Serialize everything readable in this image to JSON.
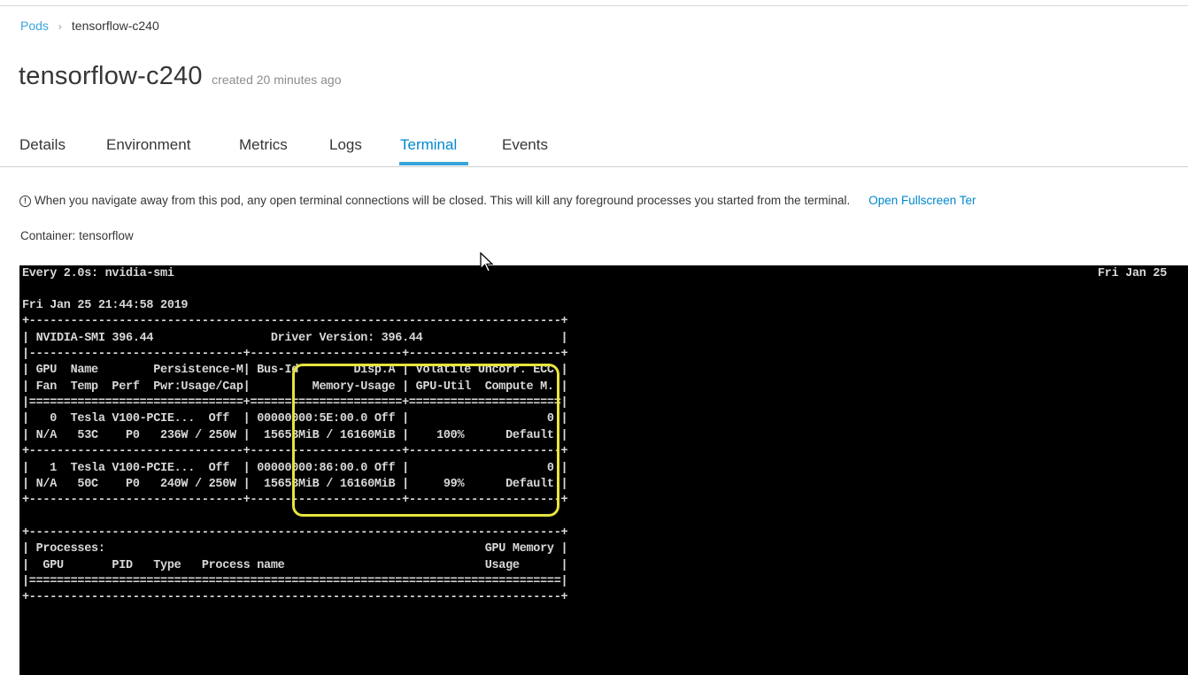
{
  "breadcrumb": {
    "root": "Pods",
    "separator": "›",
    "current": "tensorflow-c240"
  },
  "title": {
    "name": "tensorflow-c240",
    "meta": "created 20 minutes ago"
  },
  "tabs": [
    {
      "label": "Details"
    },
    {
      "label": "Environment"
    },
    {
      "label": "Metrics"
    },
    {
      "label": "Logs"
    },
    {
      "label": "Terminal",
      "active": true
    },
    {
      "label": "Events"
    }
  ],
  "notice": {
    "icon": "info-icon",
    "icon_glyph": "!",
    "text": "When you navigate away from this pod, any open terminal connections will be closed. This will kill any foreground processes you started from the terminal.",
    "link": "Open Fullscreen Ter"
  },
  "container": {
    "label": "Container:",
    "value": "tensorflow"
  },
  "terminal": {
    "header_left": "Every 2.0s: nvidia-smi",
    "header_right": "Fri Jan 25",
    "lines": [
      "Fri Jan 25 21:44:58 2019",
      "+-----------------------------------------------------------------------------+",
      "| NVIDIA-SMI 396.44                 Driver Version: 396.44                    |",
      "|-------------------------------+----------------------+----------------------+",
      "| GPU  Name        Persistence-M| Bus-Id        Disp.A | Volatile Uncorr. ECC |",
      "| Fan  Temp  Perf  Pwr:Usage/Cap|         Memory-Usage | GPU-Util  Compute M. |",
      "|===============================+======================+======================|",
      "|   0  Tesla V100-PCIE...  Off  | 00000000:5E:00.0 Off |                    0 |",
      "| N/A   53C    P0   236W / 250W |  15653MiB / 16160MiB |    100%      Default |",
      "+-------------------------------+----------------------+----------------------+",
      "|   1  Tesla V100-PCIE...  Off  | 00000000:86:00.0 Off |                    0 |",
      "| N/A   50C    P0   240W / 250W |  15653MiB / 16160MiB |     99%      Default |",
      "+-------------------------------+----------------------+----------------------+",
      "",
      "+-----------------------------------------------------------------------------+",
      "| Processes:                                                       GPU Memory |",
      "|  GPU       PID   Type   Process name                             Usage      |",
      "|=============================================================================|",
      "+-----------------------------------------------------------------------------+"
    ]
  },
  "colors": {
    "accent": "#0088ce",
    "highlight": "#e7e53a",
    "terminal_bg": "#000000"
  }
}
